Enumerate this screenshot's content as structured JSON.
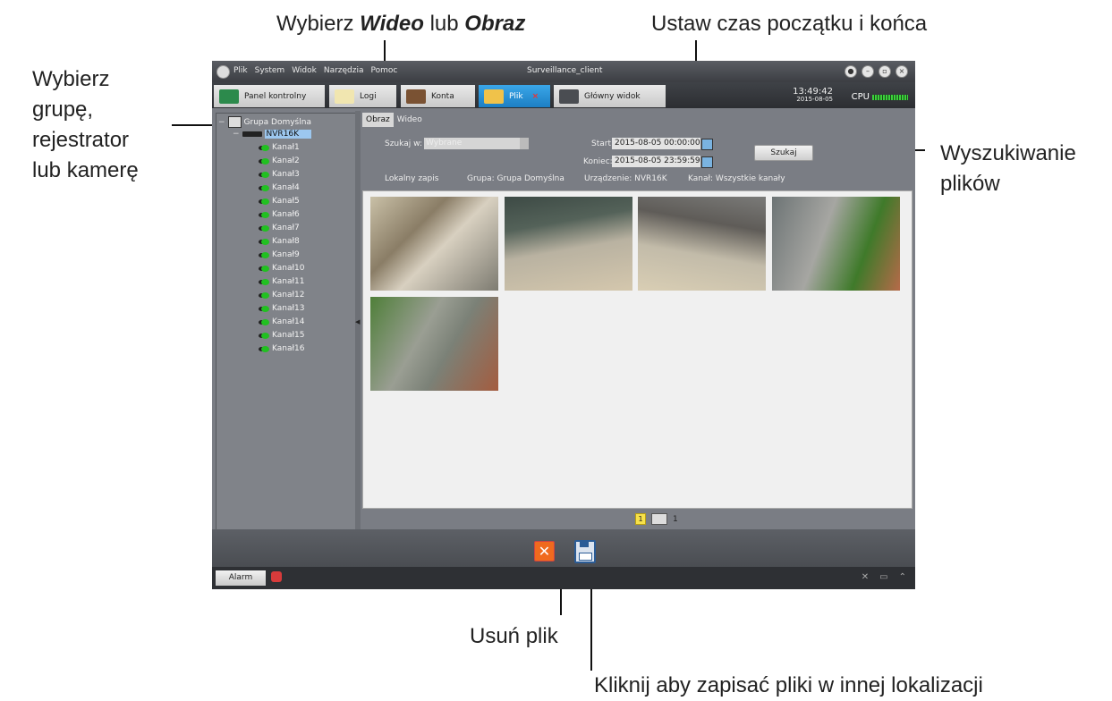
{
  "annotations": {
    "top_left_label_a": "Wybierz ",
    "top_left_bold_a": "Wideo",
    "top_left_mid": " lub ",
    "top_left_bold_b": "Obraz",
    "top_right": "Ustaw czas początku i końca",
    "left": [
      "Wybierz",
      "grupę,",
      "rejestrator",
      "lub kamerę"
    ],
    "right": [
      "Wyszukiwanie",
      "plików"
    ],
    "bottom_delete": "Usuń plik",
    "bottom_save": "Kliknij aby zapisać pliki w innej lokalizacji"
  },
  "window": {
    "title": "Surveillance_client",
    "menu": [
      "Plik",
      "System",
      "Widok",
      "Narzędzia",
      "Pomoc"
    ],
    "tabs": [
      {
        "label": "Panel kontrolny"
      },
      {
        "label": "Logi"
      },
      {
        "label": "Konta"
      },
      {
        "label": "Plik"
      },
      {
        "label": "Główny widok"
      }
    ],
    "time": "13:49:42",
    "date": "2015-08-05",
    "cpu_label": "CPU"
  },
  "tree": {
    "group": "Grupa Domyślna",
    "recorder": "NVR16K",
    "channels": [
      "Kanał1",
      "Kanał2",
      "Kanał3",
      "Kanał4",
      "Kanał5",
      "Kanał6",
      "Kanał7",
      "Kanał8",
      "Kanał9",
      "Kanał10",
      "Kanał11",
      "Kanał12",
      "Kanał13",
      "Kanał14",
      "Kanał15",
      "Kanał16"
    ]
  },
  "search": {
    "subtabs": [
      "Obraz",
      "Wideo"
    ],
    "search_in_label": "Szukaj w:",
    "search_in_value": "Wybrane",
    "start_label": "Start:",
    "start_value": "2015-08-05 00:00:00",
    "end_label": "Koniec:",
    "end_value": "2015-08-05 23:59:59",
    "search_button": "Szukaj",
    "local_record": "Lokalny zapis",
    "group_info": "Grupa:  Grupa Domyślna",
    "device_info": "Urządzenie:  NVR16K",
    "channel_info": "Kanał:  Wszystkie kanały"
  },
  "pager": {
    "current": "1",
    "total": "1"
  },
  "status": {
    "alarm": "Alarm"
  }
}
